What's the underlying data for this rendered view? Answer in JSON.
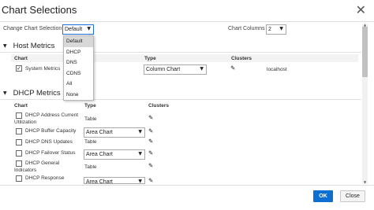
{
  "dialog": {
    "title": "Chart Selections",
    "close_glyph": "✕"
  },
  "controls": {
    "change_selection_label": "Change Chart Selection",
    "change_selection_value": "Default",
    "change_selection_options": [
      "Default",
      "DHCP",
      "DNS",
      "CDNS",
      "All",
      "None"
    ],
    "chart_columns_label": "Chart Columns",
    "chart_columns_value": "2"
  },
  "host_metrics": {
    "title": "Host Metrics",
    "columns": {
      "chart": "Chart",
      "type": "Type",
      "clusters": "Clusters"
    },
    "rows": [
      {
        "label": "System Metrics",
        "checked": true,
        "type": "Column Chart",
        "cluster": "localhost"
      }
    ]
  },
  "dhcp_metrics": {
    "title": "DHCP Metrics",
    "columns": {
      "chart": "Chart",
      "type": "Type",
      "clusters": "Clusters"
    },
    "rows": [
      {
        "label_line1": "DHCP Address Current",
        "label_line2": "Utilization",
        "type": "Table",
        "type_kind": "text"
      },
      {
        "label_line1": "DHCP Buffer Capacity",
        "label_line2": "",
        "type": "Area Chart",
        "type_kind": "select"
      },
      {
        "label_line1": "DHCP DNS Updates",
        "label_line2": "",
        "type": "Table",
        "type_kind": "text"
      },
      {
        "label_line1": "DHCP Failover Status",
        "label_line2": "",
        "type": "Area Chart",
        "type_kind": "select"
      },
      {
        "label_line1": "DHCP General",
        "label_line2": "Indicators",
        "type": "Table",
        "type_kind": "text"
      },
      {
        "label_line1": "DHCP Response",
        "label_line2": "",
        "type": "Area Chart",
        "type_kind": "select"
      }
    ]
  },
  "footer": {
    "ok_label": "OK",
    "close_label": "Close"
  },
  "icons": {
    "caret": "▼",
    "section_expanded": "▼",
    "pencil": "✎",
    "check": "✓"
  },
  "colors": {
    "primary_button": "#0d6fd1",
    "focus_border": "#1e6fd9"
  }
}
